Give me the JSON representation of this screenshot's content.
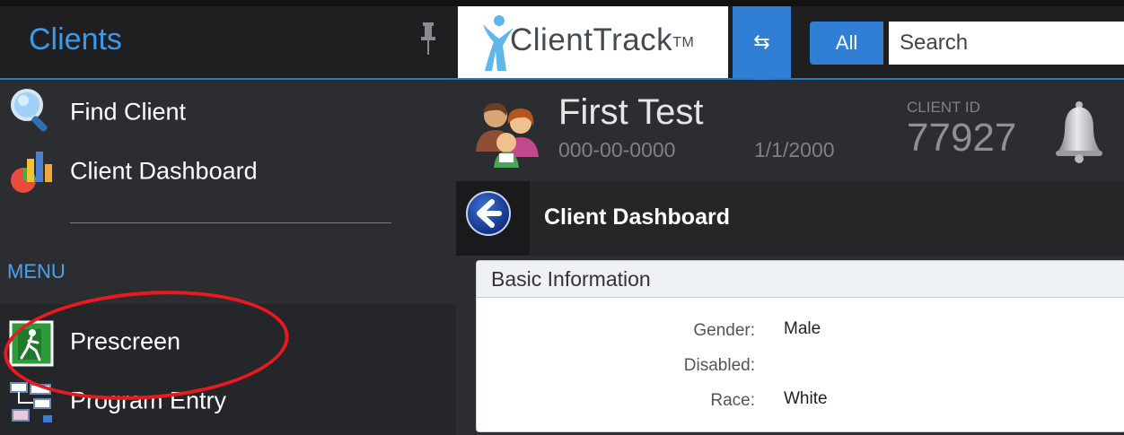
{
  "sidebar": {
    "title": "Clients",
    "items": [
      {
        "label": "Find Client",
        "icon": "magnifier-icon"
      },
      {
        "label": "Client Dashboard",
        "icon": "dashboard-chart-icon"
      }
    ],
    "menu_label": "MENU",
    "menu_items": [
      {
        "label": "Prescreen",
        "icon": "exit-door-icon"
      },
      {
        "label": "Program Entry",
        "icon": "flowchart-icon"
      }
    ]
  },
  "header": {
    "logo_text": "ClientTrack",
    "logo_tm": "TM",
    "swap_icon": "swap-arrows-icon",
    "scope_button": "All",
    "search_placeholder": "Search"
  },
  "client": {
    "name": "First Test",
    "ssn": "000-00-0000",
    "dob": "1/1/2000",
    "id_label": "CLIENT ID",
    "id_value": "77927"
  },
  "page": {
    "title": "Client Dashboard"
  },
  "basic_info": {
    "title": "Basic Information",
    "fields": [
      {
        "label": "Gender:",
        "value": "Male"
      },
      {
        "label": "Disabled:",
        "value": ""
      },
      {
        "label": "Race:",
        "value": "White"
      }
    ]
  },
  "colors": {
    "accent_blue": "#2f80d4",
    "sidebar_bg": "#2c2d31",
    "highlight_red": "#e81a20"
  }
}
